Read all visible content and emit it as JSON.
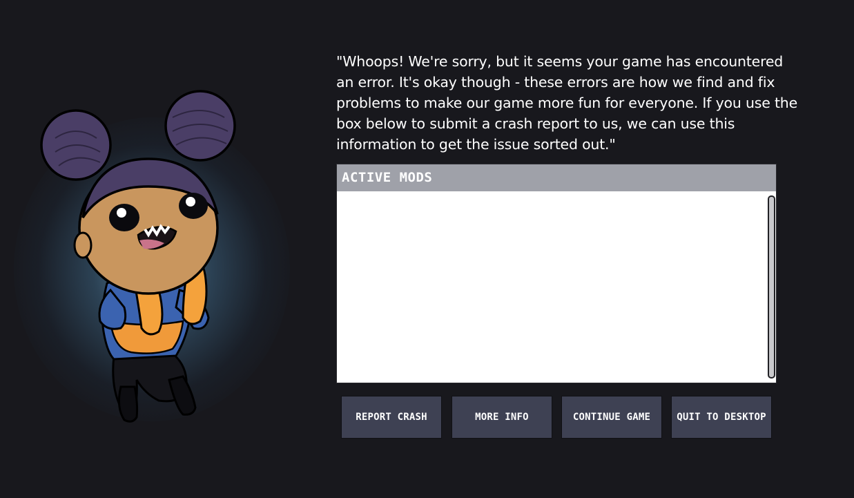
{
  "crash_screen": {
    "message": "\"Whoops! We're sorry, but it seems your game has encountered an error. It's okay though - these errors are how we find and fix problems to make our game more fun for everyone. If you use the box below to submit a crash report to us, we can use this information to get the issue sorted out.\"",
    "mods_panel": {
      "header": "ACTIVE MODS"
    },
    "buttons": {
      "report_crash": "REPORT CRASH",
      "more_info": "MORE INFO",
      "continue_game": "CONTINUE GAME",
      "quit_to_desktop": "QUIT TO DESKTOP"
    },
    "colors": {
      "background": "#18181d",
      "button": "#3e4153",
      "panel_header": "#9fa1a9",
      "glow": "#6296b4"
    }
  }
}
